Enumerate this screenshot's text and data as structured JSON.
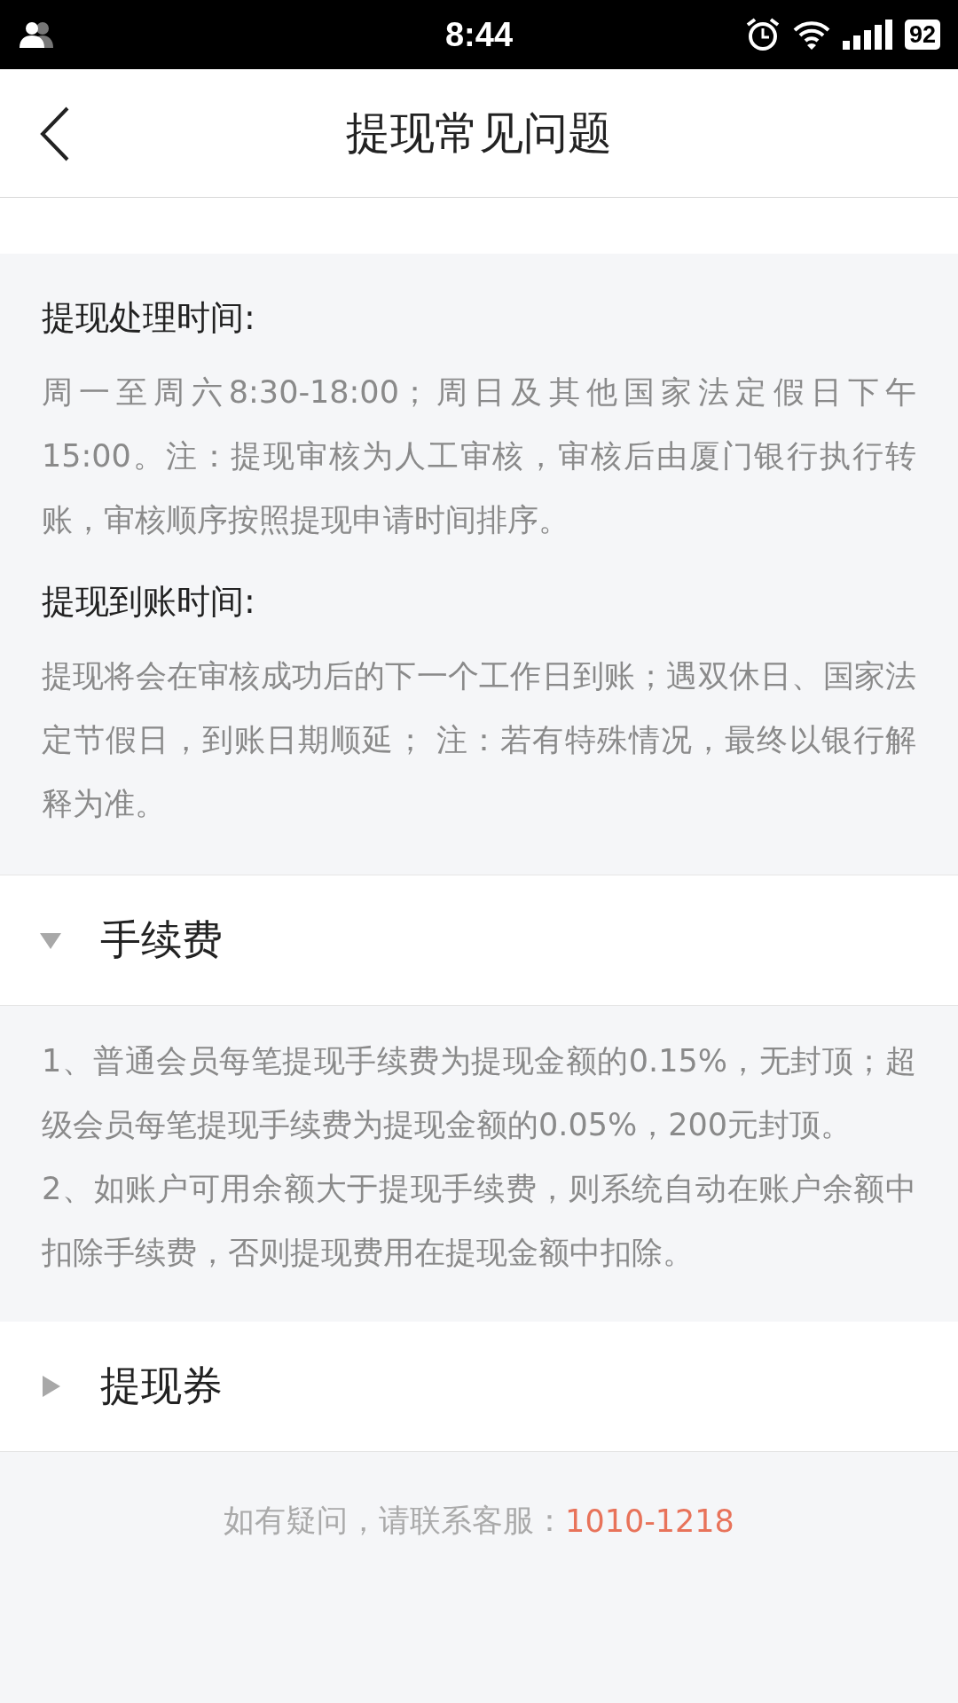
{
  "status_bar": {
    "time": "8:44",
    "battery": "92"
  },
  "header": {
    "title": "提现常见问题"
  },
  "sections": [
    {
      "kind": "details",
      "blocks": [
        {
          "heading": "提现处理时间:",
          "text": "周一至周六8:30-18:00；周日及其他国家法定假日下午15:00。注：提现审核为人工审核，审核后由厦门银行执行转账，审核顺序按照提现申请时间排序。"
        },
        {
          "heading": "提现到账时间:",
          "text": "提现将会在审核成功后的下一个工作日到账；遇双休日、国家法定节假日，到账日期顺延； 注：若有特殊情况，最终以银行解释为准。"
        }
      ]
    },
    {
      "kind": "accordion",
      "title": "手续费",
      "expanded": true,
      "paragraphs": [
        "1、普通会员每笔提现手续费为提现金额的0.15%，无封顶；超级会员每笔提现手续费为提现金额的0.05%，200元封顶。",
        "2、如账户可用余额大于提现手续费，则系统自动在账户余额中扣除手续费，否则提现费用在提现金额中扣除。"
      ]
    },
    {
      "kind": "accordion",
      "title": "提现券",
      "expanded": false
    }
  ],
  "footer": {
    "text": "如有疑问，请联系客服：",
    "phone": "1010-1218"
  }
}
